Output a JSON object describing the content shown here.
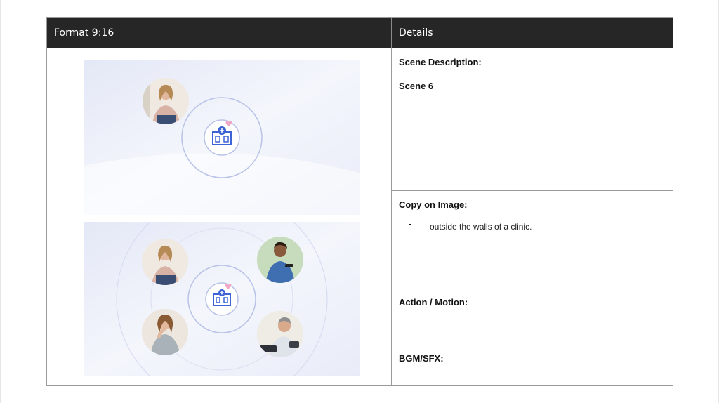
{
  "header": {
    "format": "Format 9:16",
    "details": "Details"
  },
  "frames": [
    {
      "people": [
        "woman-on-couch"
      ]
    },
    {
      "people": [
        "woman-on-couch",
        "man-with-smartwatch",
        "woman-with-hand-on-chin",
        "man-taking-blood-pressure"
      ]
    }
  ],
  "details": {
    "scene_description": {
      "label": "Scene Description:",
      "value": "Scene 6"
    },
    "copy_on_image": {
      "label": "Copy on Image:",
      "bullet": "-",
      "text": "outside the walls of a clinic."
    },
    "action_motion": {
      "label": "Action / Motion:"
    },
    "bgm_sfx": {
      "label": "BGM/SFX:"
    }
  },
  "colors": {
    "header_bg": "#262626",
    "ring": "#b9c3e8",
    "clinic_icon": "#3e63d6",
    "heart": "#f2a7c7"
  }
}
